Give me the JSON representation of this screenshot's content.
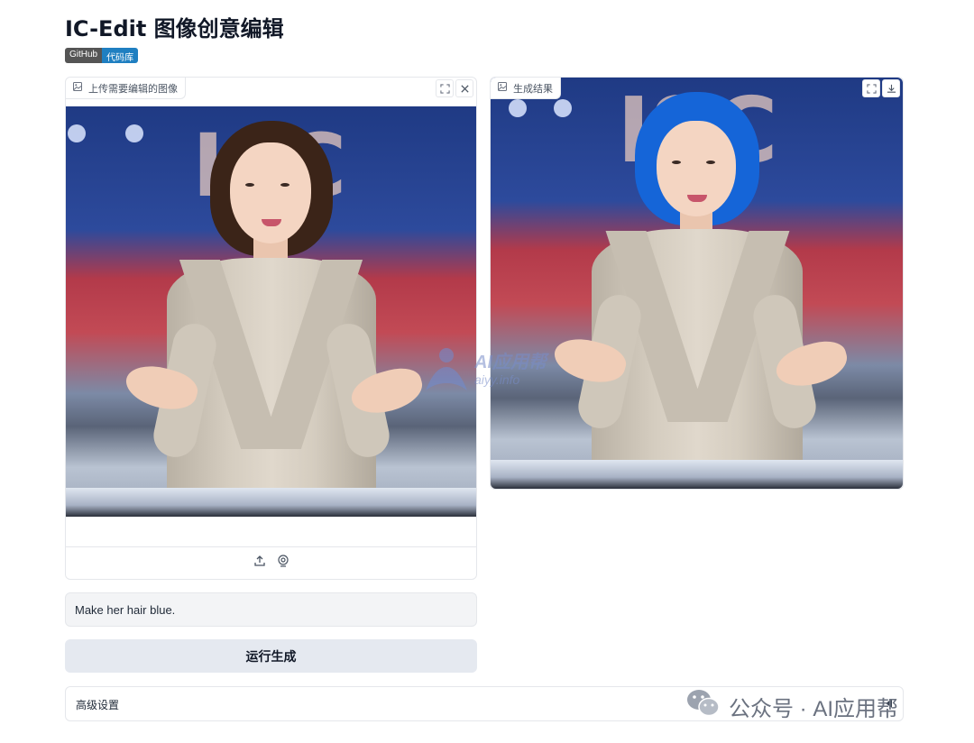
{
  "app": {
    "title": "IC-Edit 图像创意编辑",
    "badge": {
      "left": "GitHub",
      "right": "代码库"
    }
  },
  "input_panel": {
    "label": "上传需要编辑的图像",
    "tools": [
      "fullscreen-icon",
      "close-icon"
    ],
    "actions": [
      "upload-icon",
      "webcam-icon"
    ]
  },
  "output_panel": {
    "label": "生成结果",
    "tools": [
      "fullscreen-icon",
      "download-icon"
    ]
  },
  "scene": {
    "sign_text": "ISC",
    "hair_colors": {
      "input": "#3b2418",
      "output": "#1565d8"
    }
  },
  "prompt": {
    "value": "Make her hair blue."
  },
  "run_button": {
    "label": "运行生成"
  },
  "advanced": {
    "label": "高级设置"
  },
  "watermark": {
    "center_title": "AI应用帮",
    "center_sub": "aiyy.info",
    "footer": "公众号 · AI应用帮"
  }
}
